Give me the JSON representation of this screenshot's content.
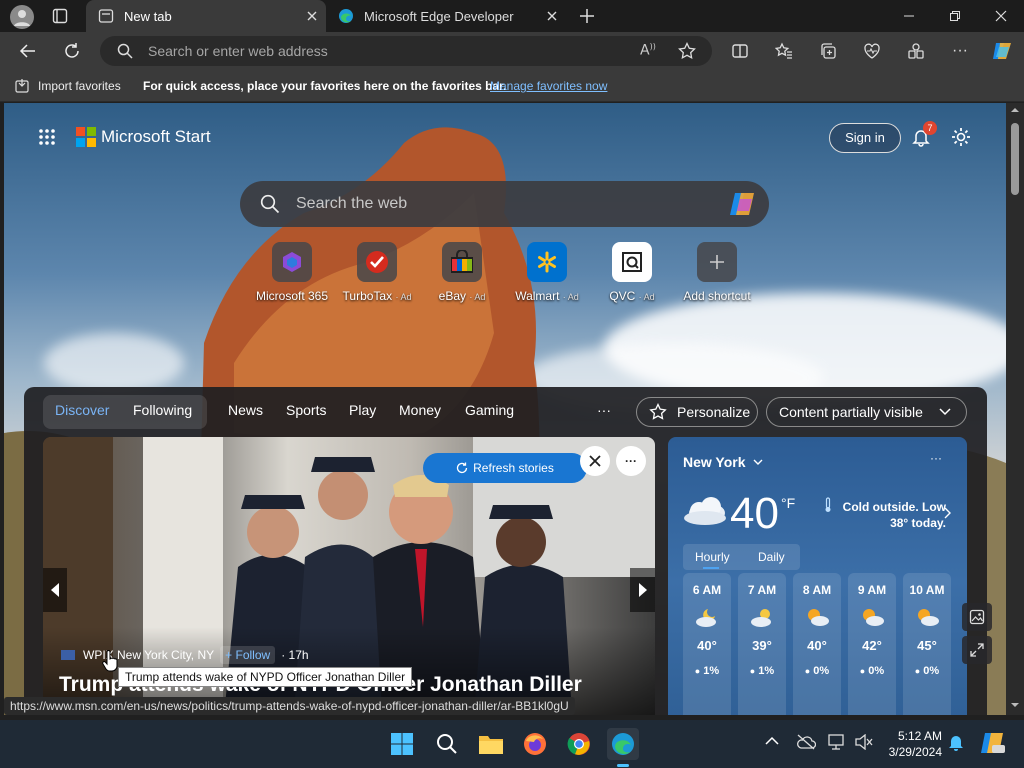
{
  "tabs": [
    {
      "title": "New tab",
      "active": true
    },
    {
      "title": "Microsoft Edge Developer",
      "active": false
    }
  ],
  "address": {
    "placeholder": "Search or enter web address"
  },
  "favorites_bar": {
    "import_label": "Import favorites",
    "hint": "For quick access, place your favorites here on the favorites bar.",
    "manage_link": "Manage favorites now"
  },
  "start": {
    "brand": "Microsoft Start",
    "sign_in": "Sign in",
    "notif_count": "7",
    "search_placeholder": "Search the web"
  },
  "shortcuts": [
    {
      "label": "Microsoft 365",
      "ad": ""
    },
    {
      "label": "TurboTax",
      "ad": "· Ad"
    },
    {
      "label": "eBay",
      "ad": "· Ad"
    },
    {
      "label": "Walmart",
      "ad": "· Ad"
    },
    {
      "label": "QVC",
      "ad": "· Ad"
    },
    {
      "label": "Add shortcut",
      "ad": ""
    }
  ],
  "feed": {
    "tabs": {
      "discover": "Discover",
      "following": "Following",
      "news": "News",
      "sports": "Sports",
      "play": "Play",
      "money": "Money",
      "gaming": "Gaming",
      "more": "···"
    },
    "personalize": "Personalize",
    "content_visibility": "Content partially visible",
    "refresh": "Refresh stories",
    "story": {
      "source": "WPIX New York City, NY",
      "follow": "+ Follow",
      "age": "· 17h",
      "headline": "Trump attends wake of NYPD Officer Jonathan Diller"
    }
  },
  "weather": {
    "location": "New York",
    "temp": "40",
    "unit": "°F",
    "note": "Cold outside. Low 38° today.",
    "tab_hourly": "Hourly",
    "tab_daily": "Daily",
    "hours": [
      {
        "time": "6 AM",
        "temp": "40°",
        "precip": "1%"
      },
      {
        "time": "7 AM",
        "temp": "39°",
        "precip": "1%"
      },
      {
        "time": "8 AM",
        "temp": "40°",
        "precip": "0%"
      },
      {
        "time": "9 AM",
        "temp": "42°",
        "precip": "0%"
      },
      {
        "time": "10 AM",
        "temp": "45°",
        "precip": "0%"
      }
    ]
  },
  "status_url": "https://www.msn.com/en-us/news/politics/trump-attends-wake-of-nypd-officer-jonathan-diller/ar-BB1kl0gU",
  "tooltip": "Trump attends wake of NYPD Officer Jonathan Diller",
  "clock": {
    "time": "5:12 AM",
    "date": "3/29/2024"
  },
  "colors": {
    "accent": "#4ea3f1",
    "link": "#7fbfff",
    "badge": "#e0452f"
  }
}
